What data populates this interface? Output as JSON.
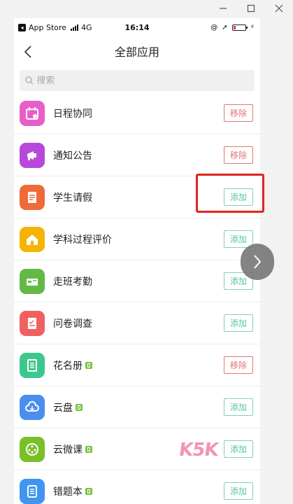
{
  "status_bar": {
    "carrier": "App Store",
    "network": "4G",
    "time": "16:14"
  },
  "nav": {
    "title": "全部应用"
  },
  "search": {
    "placeholder": "搜索"
  },
  "apps": [
    {
      "name": "日程协同",
      "action": "移除",
      "action_type": "remove",
      "icon": "calendar-icon",
      "color": "#e85ec8",
      "new": false
    },
    {
      "name": "通知公告",
      "action": "移除",
      "action_type": "remove",
      "icon": "megaphone-icon",
      "color": "#b848d9",
      "new": false
    },
    {
      "name": "学生请假",
      "action": "添加",
      "action_type": "add",
      "icon": "leave-form-icon",
      "color": "#ef6a3a",
      "new": false
    },
    {
      "name": "学科过程评价",
      "action": "添加",
      "action_type": "add",
      "icon": "house-icon",
      "color": "#f5b400",
      "new": false
    },
    {
      "name": "走班考勤",
      "action": "添加",
      "action_type": "add",
      "icon": "attendance-icon",
      "color": "#63b944",
      "new": false
    },
    {
      "name": "问卷调查",
      "action": "添加",
      "action_type": "add",
      "icon": "survey-icon",
      "color": "#f06060",
      "new": false
    },
    {
      "name": "花名册",
      "action": "移除",
      "action_type": "remove",
      "icon": "roster-icon",
      "color": "#3cc88c",
      "new": true
    },
    {
      "name": "云盘",
      "action": "添加",
      "action_type": "add",
      "icon": "cloud-icon",
      "color": "#4c8ef0",
      "new": true
    },
    {
      "name": "云微课",
      "action": "添加",
      "action_type": "add",
      "icon": "microlesson-icon",
      "color": "#7ac029",
      "new": true
    },
    {
      "name": "错题本",
      "action": "添加",
      "action_type": "add",
      "icon": "notebook-icon",
      "color": "#3f95f0",
      "new": true
    }
  ],
  "watermark": "K5K",
  "colors": {
    "remove": "#e57373",
    "add": "#52c79a",
    "highlight": "#e0241e"
  }
}
